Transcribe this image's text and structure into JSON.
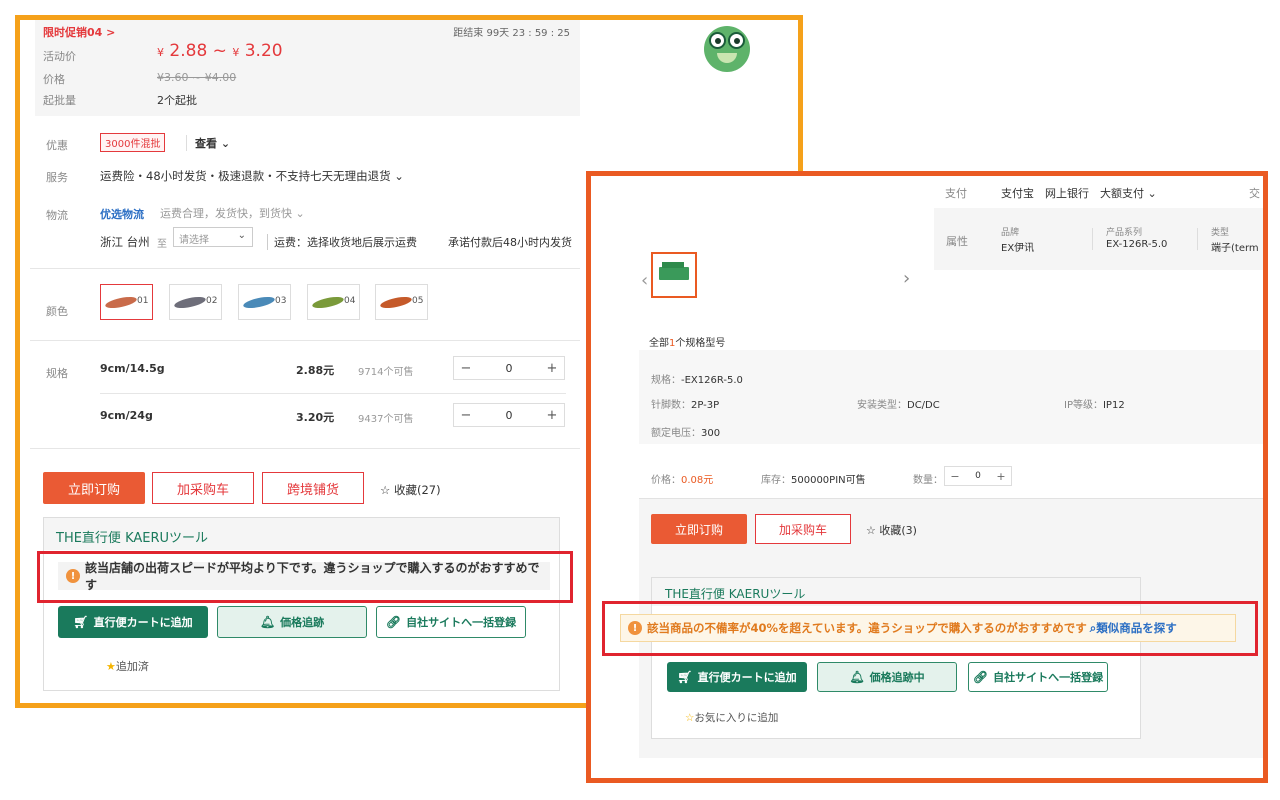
{
  "left": {
    "promo_title": "限时促销04 >",
    "countdown": "距结束 99天 23 : 59 : 25",
    "price_rows": {
      "activity_label": "活动价",
      "activity_low": "2.88",
      "activity_sep": "~",
      "activity_high": "3.20",
      "currency": "¥",
      "orig_label": "价格",
      "orig_price": "¥3.60 ~ ¥4.00",
      "moq_label": "起批量",
      "moq_value": "2个起批"
    },
    "discount_label": "优惠",
    "discount_badge": "3000件混批",
    "discount_view": "查看",
    "service_label": "服务",
    "services": "运费险・48小时发货・极速退款・不支持七天无理由退货",
    "logistics_label": "物流",
    "logistics_fast": "优选物流",
    "logistics_note": "运费合理，发货快，到货快",
    "ship_from": "浙江 台州",
    "ship_to": "至",
    "ship_select": "请选择",
    "ship_fee": "运费：选择收货地后展示运费",
    "ship_promise": "承诺付款后48小时内发货",
    "color_label": "颜色",
    "colors": [
      "01",
      "02",
      "03",
      "04",
      "05"
    ],
    "color_fills": [
      "#c96b4a",
      "#6e6e7a",
      "#4a8ab8",
      "#7a9a3a",
      "#c55a2a"
    ],
    "spec_label": "规格",
    "specs": [
      {
        "name": "9cm/14.5g",
        "price": "2.88元",
        "stock": "9714个可售",
        "qty": "0"
      },
      {
        "name": "9cm/24g",
        "price": "3.20元",
        "stock": "9437个可售",
        "qty": "0"
      }
    ],
    "buy_now": "立即订购",
    "add_cart": "加采购车",
    "cross_border": "跨境铺货",
    "favorite": "收藏(27)",
    "kaeru_title": "THE直行便 KAERUツール",
    "warning": "該当店舗の出荷スピードが平均より下です。違うショップで購入するのがおすすめです",
    "k_add_cart": "直行便カートに追加",
    "k_track": "価格追跡",
    "k_register": "自社サイトへ一括登録",
    "k_added": "追加済"
  },
  "right": {
    "pay_label": "支付",
    "pay_methods": "支付宝　网上银行　大额支付",
    "pay_extra": "交",
    "attr_label": "属性",
    "attrs": [
      {
        "k": "品牌",
        "v": "EX伊讯"
      },
      {
        "k": "产品系列",
        "v": "EX-126R-5.0"
      },
      {
        "k": "类型",
        "v": "端子(term"
      }
    ],
    "spec_count_pre": "全部",
    "spec_count_num": "1",
    "spec_count_post": "个规格型号",
    "spec_model_k": "规格：",
    "spec_model_v": "-EX126R-5.0",
    "pins_k": "针脚数：",
    "pins_v": "2P-3P",
    "mount_k": "安装类型：",
    "mount_v": "DC/DC",
    "ip_k": "IP等级：",
    "ip_v": "IP12",
    "voltage_k": "额定电压：",
    "voltage_v": "300",
    "price_k": "价格：",
    "price_v": "0.08元",
    "stock_k": "库存：",
    "stock_v": "500000PIN可售",
    "qty_k": "数量：",
    "qty_v": "0",
    "buy_now": "立即订购",
    "add_cart": "加采购车",
    "favorite": "收藏(3)",
    "kaeru_title": "THE直行便 KAERUツール",
    "warning": "該当商品の不備率が40%を超えています。違うショップで購入するのがおすすめです",
    "similar": "類似商品を探す",
    "k_add_cart": "直行便カートに追加",
    "k_track": "価格追跡中",
    "k_register": "自社サイトへ一括登録",
    "k_fav": "お気に入りに追加"
  },
  "colors": {
    "left_frame": "#f5a11a",
    "right_frame": "#ea5a22",
    "highlight_frame": "#e0242f",
    "accent_red": "#e4393c",
    "kaeru_green": "#1a7a5c"
  }
}
